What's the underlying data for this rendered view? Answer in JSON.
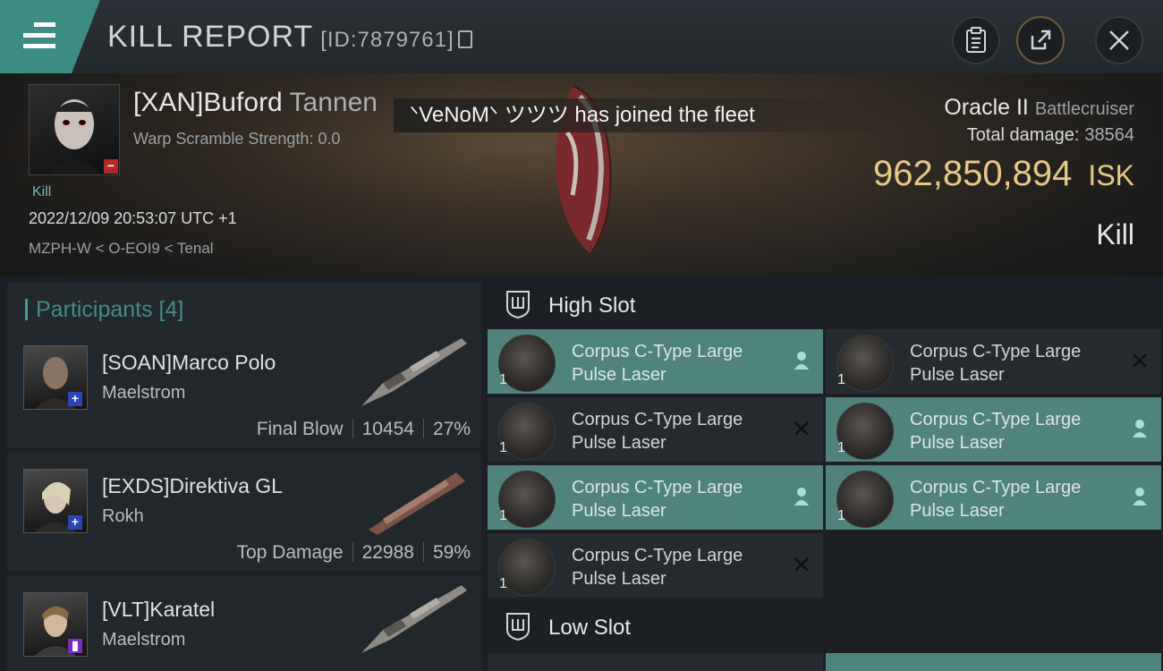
{
  "header": {
    "menu_icon": "hamburger-icon",
    "title": "KILL REPORT",
    "report_id": "[ID:7879761]",
    "icons": [
      "clipboard-icon",
      "share-icon",
      "close-icon"
    ]
  },
  "victim": {
    "name": "[XAN]Buford",
    "name_rest": "Tannen",
    "warp": "Warp Scramble Strength: 0.0",
    "tag": "Kill",
    "datetime": "2022/12/09 20:53:07 UTC +1",
    "location": "MZPH-W < O-EOI9 < Tenal"
  },
  "notification": "ᐠVeNoMᐠ ツツツ has joined the fleet",
  "ship": {
    "name": "Oracle II",
    "class": "Battlecruiser",
    "total_damage_label": "Total damage:",
    "total_damage": "38564",
    "isk_value": "962,850,894",
    "isk_unit": "ISK",
    "result": "Kill"
  },
  "participants": {
    "title": "Participants [4]",
    "rows": [
      {
        "name": "[SOAN]Marco Polo",
        "ship": "Maelstrom",
        "stat_label": "Final Blow",
        "damage": "10454",
        "percent": "27%"
      },
      {
        "name": "[EXDS]Direktiva GL",
        "ship": "Rokh",
        "stat_label": "Top Damage",
        "damage": "22988",
        "percent": "59%"
      },
      {
        "name": "[VLT]Karatel",
        "ship": "Maelstrom"
      }
    ]
  },
  "slots": {
    "high": {
      "label": "High Slot",
      "modules": [
        {
          "name": "Corpus C-Type Large Pulse Laser",
          "qty": "1",
          "status": "person-icon"
        },
        {
          "name": "Corpus C-Type Large Pulse Laser",
          "qty": "1",
          "status": "x-icon"
        },
        {
          "name": "Corpus C-Type Large Pulse Laser",
          "qty": "1",
          "status": "x-icon"
        },
        {
          "name": "Corpus C-Type Large Pulse Laser",
          "qty": "1",
          "status": "person-icon"
        },
        {
          "name": "Corpus C-Type Large Pulse Laser",
          "qty": "1",
          "status": "person-icon"
        },
        {
          "name": "Corpus C-Type Large Pulse Laser",
          "qty": "1",
          "status": "person-icon"
        },
        {
          "name": "Corpus C-Type Large Pulse Laser",
          "qty": "1",
          "status": "x-icon"
        }
      ]
    },
    "low": {
      "label": "Low Slot"
    }
  },
  "colors": {
    "accent": "#3f8f88",
    "isk": "#e7c983",
    "dropped": "#4f837c",
    "bg": "#1c2024"
  }
}
